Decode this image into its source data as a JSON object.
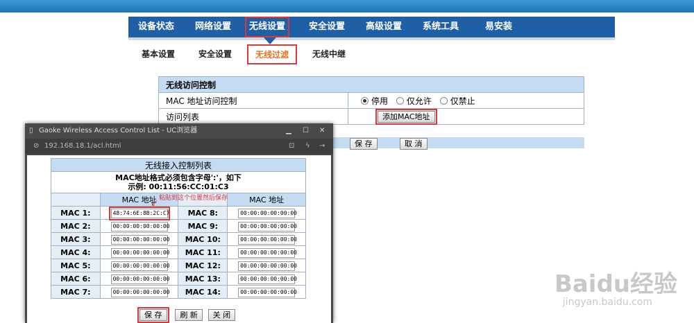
{
  "nav": {
    "items": [
      "设备状态",
      "网络设置",
      "无线设置",
      "安全设置",
      "高级设置",
      "系统工具",
      "易安装"
    ],
    "active": "无线设置"
  },
  "subnav": {
    "items": [
      "基本设置",
      "安全设置",
      "无线过滤",
      "无线中继"
    ],
    "active": "无线过滤"
  },
  "acl": {
    "title": "无线访问控制",
    "mac_control_label": "MAC 地址访问控制",
    "options": [
      "停用",
      "仅允许",
      "仅禁止"
    ],
    "selected": "停用",
    "list_label": "访问列表",
    "add_button": "添加MAC地址",
    "save": "保 存",
    "cancel": "取 消"
  },
  "popup": {
    "window_title": "Gaoke Wireless Access Control List - UC浏览器",
    "url": "192.168.18.1/acl.html",
    "table_title": "无线接入控制列表",
    "note_line1": "MAC地址格式必须包含字母':'，如下",
    "note_line2": "示例: 00:11:56:CC:01:C3",
    "col_header": "MAC 地址",
    "annotation": "粘贴到这个位置然后保存",
    "rows_left": [
      {
        "label": "MAC 1:",
        "value": "48:74:6E:8B:2C:C7"
      },
      {
        "label": "MAC 2:",
        "value": "00:00:00:00:00:00"
      },
      {
        "label": "MAC 3:",
        "value": "00:00:00:00:00:00"
      },
      {
        "label": "MAC 4:",
        "value": "00:00:00:00:00:00"
      },
      {
        "label": "MAC 5:",
        "value": "00:00:00:00:00:00"
      },
      {
        "label": "MAC 6:",
        "value": "00:00:00:00:00:00"
      },
      {
        "label": "MAC 7:",
        "value": "00:00:00:00:00:00"
      }
    ],
    "rows_right": [
      {
        "label": "MAC 8:",
        "value": "00:00:00:00:00:00"
      },
      {
        "label": "MAC 9:",
        "value": "00:00:00:00:00:00"
      },
      {
        "label": "MAC 10:",
        "value": "00:00:00:00:00:00"
      },
      {
        "label": "MAC 11:",
        "value": "00:00:00:00:00:00"
      },
      {
        "label": "MAC 12:",
        "value": "00:00:00:00:00:00"
      },
      {
        "label": "MAC 13:",
        "value": "00:00:00:00:00:00"
      },
      {
        "label": "MAC 14:",
        "value": "00:00:00:00:00:00"
      }
    ],
    "save": "保 存",
    "refresh": "刷 新",
    "close": "关 闭"
  },
  "watermark": {
    "brand": "Baidu经验",
    "url": "jingyan.baidu.com"
  }
}
